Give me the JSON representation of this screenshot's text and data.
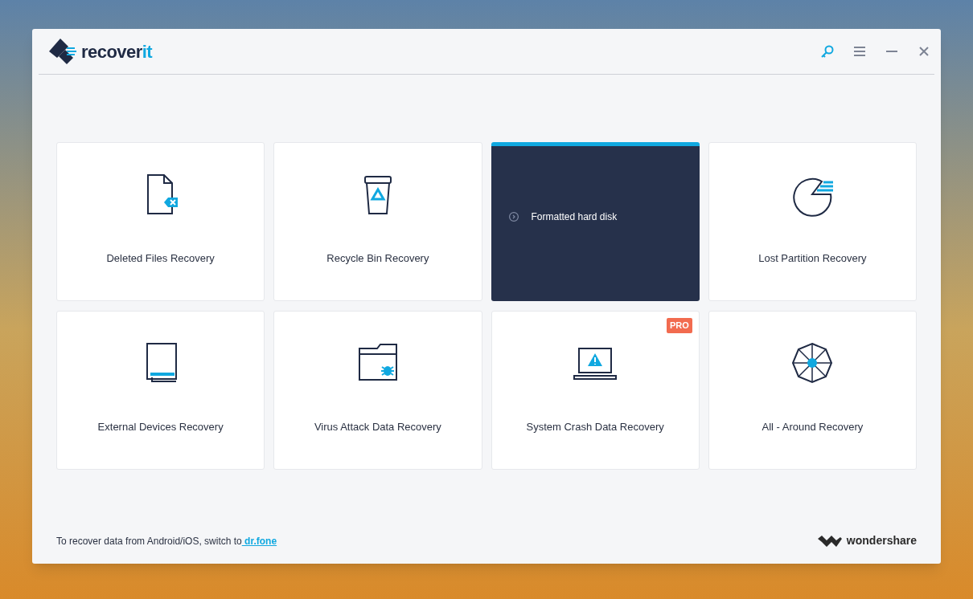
{
  "window": {
    "logo": {
      "text_main": "recover",
      "text_accent": "it"
    }
  },
  "cards": [
    {
      "kind": "deleted-file",
      "label": "Deleted Files Recovery",
      "selected": false,
      "pro": false
    },
    {
      "kind": "recycle-bin",
      "label": "Recycle Bin Recovery",
      "selected": false,
      "pro": false
    },
    {
      "label": "Formatted hard disk",
      "selected": true,
      "pro": false
    },
    {
      "kind": "partition",
      "label": "Lost Partition Recovery",
      "selected": false,
      "pro": false
    },
    {
      "kind": "external",
      "label": "External Devices Recovery",
      "selected": false,
      "pro": false
    },
    {
      "kind": "virus",
      "label": "Virus Attack Data Recovery",
      "selected": false,
      "pro": false
    },
    {
      "kind": "crash",
      "label": "System Crash Data Recovery",
      "selected": false,
      "pro": true,
      "badge": "PRO"
    },
    {
      "kind": "all-around",
      "label": "All - Around Recovery",
      "selected": false,
      "pro": false
    }
  ],
  "footer": {
    "text": "To recover data from Android/iOS, switch to",
    "link": " dr.fone",
    "brand": "wondershare"
  }
}
